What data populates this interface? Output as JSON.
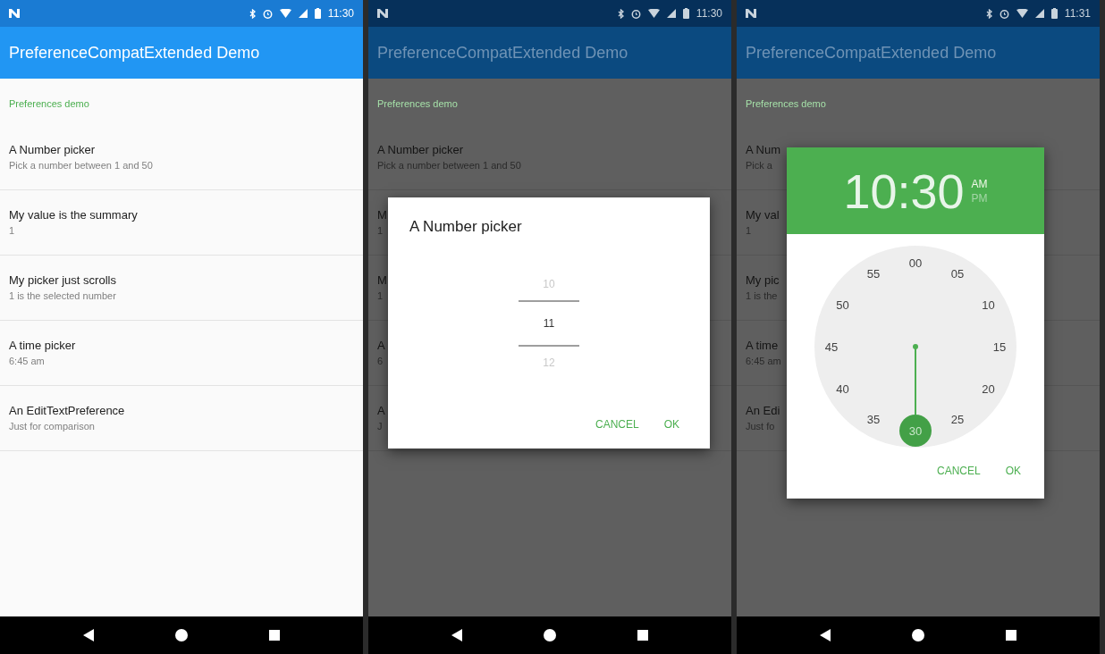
{
  "screens": [
    {
      "dimmed": false,
      "status_bar": {
        "time": "11:30"
      },
      "app_bar": {
        "title": "PreferenceCompatExtended Demo"
      },
      "category": "Preferences demo",
      "items": [
        {
          "title": "A Number picker",
          "summary": "Pick a number between 1 and 50"
        },
        {
          "title": "My value is the summary",
          "summary": "1"
        },
        {
          "title": "My picker just scrolls",
          "summary": "1 is the selected number"
        },
        {
          "title": "A time picker",
          "summary": "6:45 am"
        },
        {
          "title": "An EditTextPreference",
          "summary": "Just for comparison"
        }
      ]
    },
    {
      "dimmed": true,
      "status_bar": {
        "time": "11:30"
      },
      "app_bar": {
        "title": "PreferenceCompatExtended Demo"
      },
      "category": "Preferences demo",
      "items": [
        {
          "title": "A Number picker",
          "summary": "Pick a number between 1 and 50"
        },
        {
          "title": "M",
          "summary": "1"
        },
        {
          "title": "M",
          "summary": "1"
        },
        {
          "title": "A",
          "summary": "6"
        },
        {
          "title": "A",
          "summary": "J"
        }
      ],
      "dialog": {
        "kind": "number_picker",
        "title": "A Number picker",
        "values": [
          {
            "label": "10",
            "selected": false
          },
          {
            "label": "11",
            "selected": true
          },
          {
            "label": "12",
            "selected": false
          }
        ],
        "buttons": [
          "CANCEL",
          "OK"
        ]
      }
    },
    {
      "dimmed": true,
      "status_bar": {
        "time": "11:31"
      },
      "app_bar": {
        "title": "PreferenceCompatExtended Demo"
      },
      "category": "Preferences demo",
      "items": [
        {
          "title": "A Num",
          "summary": "Pick a"
        },
        {
          "title": "My val",
          "summary": "1"
        },
        {
          "title": "My pic",
          "summary": "1 is the"
        },
        {
          "title": "A time",
          "summary": "6:45 am"
        },
        {
          "title": "An Edi",
          "summary": "Just fo"
        }
      ],
      "dialog": {
        "kind": "time_picker",
        "time": "10:30",
        "periods": [
          {
            "label": "AM",
            "selected": true
          },
          {
            "label": "PM",
            "selected": false
          }
        ],
        "minutes": [
          {
            "label": "00",
            "selected": false
          },
          {
            "label": "05",
            "selected": false
          },
          {
            "label": "10",
            "selected": false
          },
          {
            "label": "15",
            "selected": false
          },
          {
            "label": "20",
            "selected": false
          },
          {
            "label": "25",
            "selected": false
          },
          {
            "label": "30",
            "selected": true
          },
          {
            "label": "35",
            "selected": false
          },
          {
            "label": "40",
            "selected": false
          },
          {
            "label": "45",
            "selected": false
          },
          {
            "label": "50",
            "selected": false
          },
          {
            "label": "55",
            "selected": false
          }
        ],
        "buttons": [
          "CANCEL",
          "OK"
        ]
      }
    }
  ]
}
